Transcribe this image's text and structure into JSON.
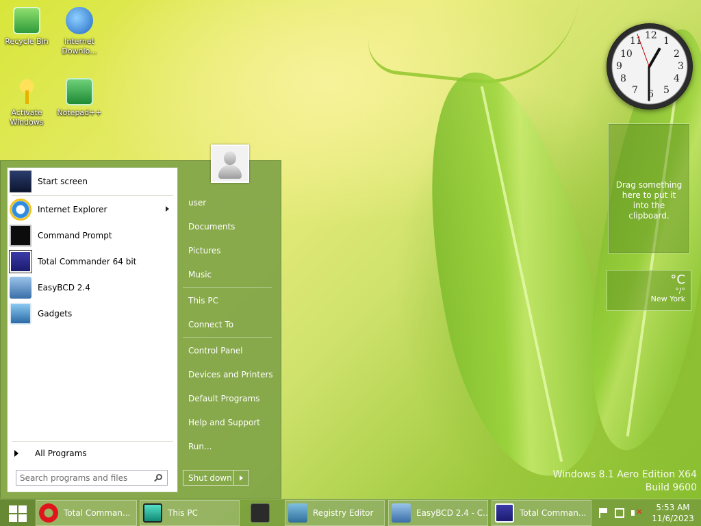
{
  "desktop": {
    "icons": [
      {
        "label": "Recycle Bin",
        "icon": "recycle-bin-icon"
      },
      {
        "label": "Internet Downlo...",
        "icon": "internet-download-manager-icon"
      },
      {
        "label": "Activate Windows",
        "icon": "key-icon"
      },
      {
        "label": "Notepad++",
        "icon": "notepadpp-icon"
      }
    ],
    "watermark": {
      "line1": "Windows 8.1 Aero Edition X64",
      "line2": "Build 9600"
    }
  },
  "gadgets": {
    "clock": {
      "numbers": [
        "12",
        "1",
        "2",
        "3",
        "4",
        "5",
        "6",
        "7",
        "8",
        "9",
        "10",
        "11"
      ]
    },
    "clipboard": {
      "text": "Drag something here to put it into the clipboard."
    },
    "weather": {
      "unit": "°C",
      "range": "°/°",
      "city": "New York"
    }
  },
  "start_menu": {
    "programs": [
      {
        "label": "Start screen",
        "icon": "start-screen-icon",
        "has_submenu": false
      },
      {
        "label": "Internet Explorer",
        "icon": "internet-explorer-icon",
        "has_submenu": true
      },
      {
        "label": "Command Prompt",
        "icon": "command-prompt-icon",
        "has_submenu": false
      },
      {
        "label": "Total Commander 64 bit",
        "icon": "total-commander-icon",
        "has_submenu": false
      },
      {
        "label": "EasyBCD 2.4",
        "icon": "easybcd-icon",
        "has_submenu": false
      },
      {
        "label": "Gadgets",
        "icon": "gadgets-icon",
        "has_submenu": false
      }
    ],
    "all_programs": "All Programs",
    "search_placeholder": "Search programs and files",
    "right_items": [
      "user",
      "Documents",
      "Pictures",
      "Music",
      "This PC",
      "Connect To",
      "Control Panel",
      "Devices and Printers",
      "Default Programs",
      "Help and Support",
      "Run..."
    ],
    "shutdown_label": "Shut down"
  },
  "taskbar": {
    "tasks": [
      {
        "label": "Total Comman...",
        "icon": "opera-icon"
      },
      {
        "label": "This PC",
        "icon": "monitor-icon"
      },
      {
        "label": "",
        "icon": "calculator-icon"
      },
      {
        "label": "Registry Editor",
        "icon": "registry-editor-icon"
      },
      {
        "label": "EasyBCD 2.4 - C...",
        "icon": "easybcd-icon"
      },
      {
        "label": "Total Comman...",
        "icon": "total-commander-icon"
      }
    ],
    "time": "5:53 AM",
    "date": "11/6/2023"
  }
}
